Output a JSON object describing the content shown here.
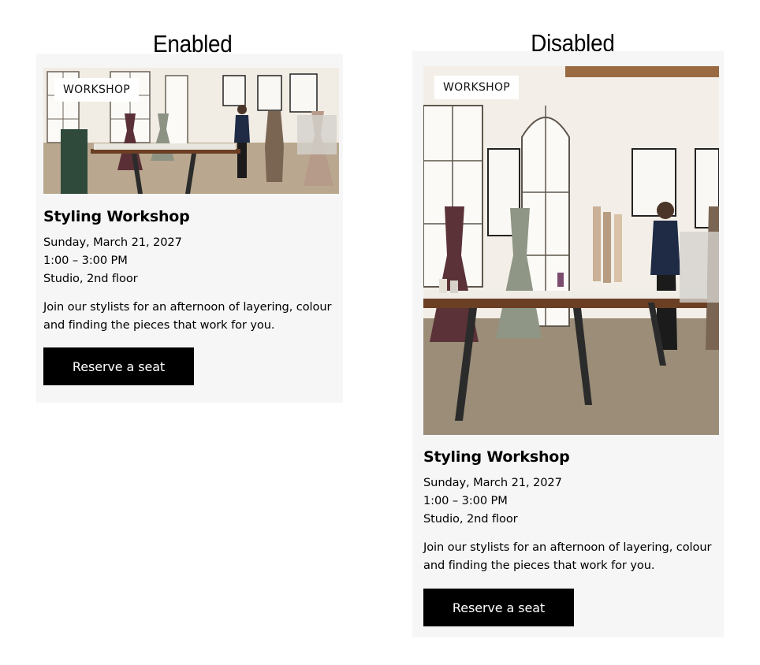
{
  "states": {
    "enabled_label": "Enabled",
    "disabled_label": "Disabled"
  },
  "cards": {
    "enabled": {
      "badge": "WORKSHOP",
      "title": "Styling Workshop",
      "date": "Sunday, March 21, 2027",
      "time": "1:00 – 3:00 PM",
      "location": "Studio, 2nd floor",
      "description": "Join our stylists for an afternoon of layering, colour and finding the pieces that work for you.",
      "cta_label": "Reserve a seat"
    },
    "disabled": {
      "badge": "WORKSHOP",
      "title": "Styling Workshop",
      "date": "Sunday, March 21, 2027",
      "time": "1:00 – 3:00 PM",
      "location": "Studio, 2nd floor",
      "description": "Join our stylists for an afternoon of layering, colour and finding the pieces that work for you.",
      "cta_label": "Reserve a seat"
    }
  },
  "colors": {
    "card_background": "#f6f6f6",
    "button_background": "#000000",
    "button_text": "#ffffff",
    "badge_background": "#ffffff"
  }
}
